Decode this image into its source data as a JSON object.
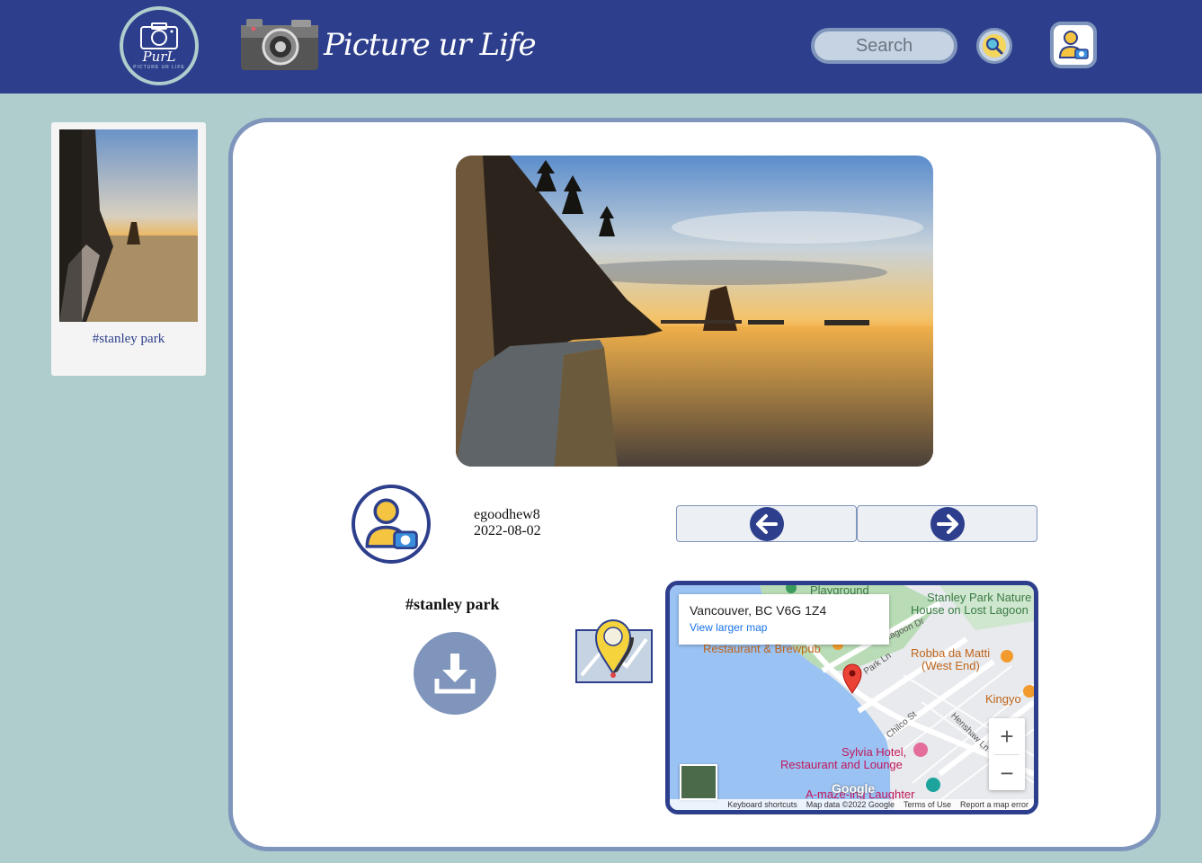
{
  "header": {
    "brand_initials": "PurL",
    "brand_tagline": "PICTURE UR LIFE",
    "logo_text": "Picture ur Life",
    "search_placeholder": "Search"
  },
  "sidebar": {
    "cards": [
      {
        "caption": "#stanley park"
      }
    ]
  },
  "post": {
    "username": "egoodhew8",
    "date": "2022-08-02",
    "tag": "#stanley park"
  },
  "map": {
    "address": "Vancouver, BC V6G 1Z4",
    "larger_map_link": "View larger map",
    "labels": {
      "playground": "Playground",
      "nature_house": "Stanley Park Nature",
      "nature_house_2": "House on Lost Lagoon",
      "restaurant_brewpub": "Restaurant & Brewpub",
      "robba": "Robba da Matti",
      "robba_2": "(West End)",
      "kingyo": "Kingyo",
      "sylvia": "Sylvia Hotel,",
      "sylvia_2": "Restaurant and Lounge",
      "amaze": "A-maze-ing Laughter",
      "park_ln": "Park Ln",
      "lagoon_dr": "Lagoon Dr",
      "chilco": "Chilco St",
      "henshaw": "Henshaw Ln",
      "google": "Google"
    },
    "zoom_in": "+",
    "zoom_out": "−",
    "footer": {
      "shortcuts": "Keyboard shortcuts",
      "map_data": "Map data ©2022 Google",
      "terms": "Terms of Use",
      "report": "Report a map error"
    }
  },
  "colors": {
    "header_bg": "#2d3f8c",
    "page_bg": "#b0cdcd",
    "accent": "#7f95bb"
  },
  "icons": {
    "search": "search-icon",
    "profile": "profile-icon",
    "arrow_left": "arrow-left-icon",
    "arrow_right": "arrow-right-icon",
    "download": "download-icon",
    "map_pin": "map-pin-icon"
  }
}
